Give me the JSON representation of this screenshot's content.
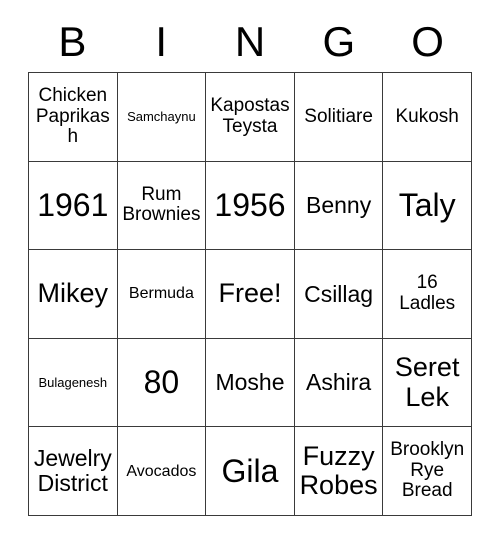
{
  "card": {
    "header_letters": [
      "B",
      "I",
      "N",
      "G",
      "O"
    ],
    "free_space_label": "Free!",
    "colors": {
      "border": "#3a3a3a",
      "text": "#000000",
      "background": "#ffffff"
    },
    "grid": {
      "rows": 5,
      "columns": 5,
      "cells": [
        {
          "text": "Chicken\nPaprikash",
          "size": "md"
        },
        {
          "text": "Samchaynu",
          "size": "xs"
        },
        {
          "text": "Kapostas\nTeysta",
          "size": "md"
        },
        {
          "text": "Solitiare",
          "size": "md"
        },
        {
          "text": "Kukosh",
          "size": "md"
        },
        {
          "text": "1961",
          "size": "xxl"
        },
        {
          "text": "Rum\nBrownies",
          "size": "md"
        },
        {
          "text": "1956",
          "size": "xxl"
        },
        {
          "text": "Benny",
          "size": "lg"
        },
        {
          "text": "Taly",
          "size": "xxl"
        },
        {
          "text": "Mikey",
          "size": "xl"
        },
        {
          "text": "Bermuda",
          "size": "sm"
        },
        {
          "text": "Free!",
          "size": "xl"
        },
        {
          "text": "Csillag",
          "size": "lg"
        },
        {
          "text": "16\nLadles",
          "size": "md"
        },
        {
          "text": "Bulagenesh",
          "size": "xs"
        },
        {
          "text": "80",
          "size": "xxl"
        },
        {
          "text": "Moshe",
          "size": "lg"
        },
        {
          "text": "Ashira",
          "size": "lg"
        },
        {
          "text": "Seret\nLek",
          "size": "xl"
        },
        {
          "text": "Jewelry\nDistrict",
          "size": "lg"
        },
        {
          "text": "Avocados",
          "size": "sm"
        },
        {
          "text": "Gila",
          "size": "xxl"
        },
        {
          "text": "Fuzzy\nRobes",
          "size": "xl"
        },
        {
          "text": "Brooklyn\nRye\nBread",
          "size": "md"
        }
      ]
    }
  }
}
